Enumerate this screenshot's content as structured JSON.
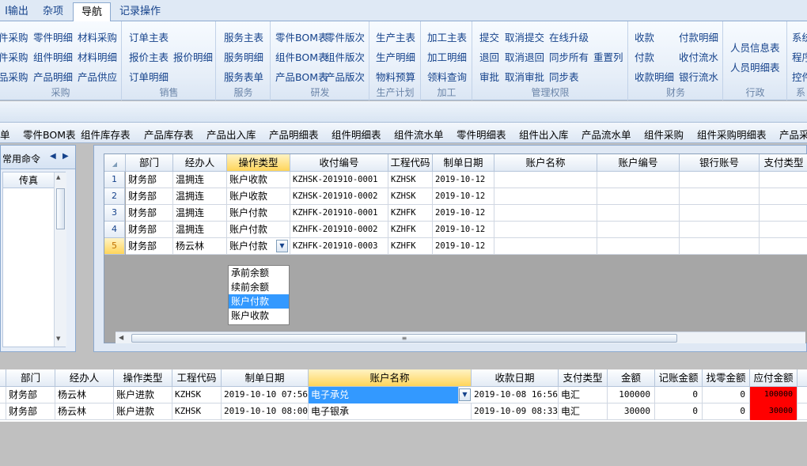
{
  "ribbon_tabs": [
    {
      "label": "I输出",
      "active": false
    },
    {
      "label": "杂项",
      "active": false
    },
    {
      "label": "导航",
      "active": true
    },
    {
      "label": "记录操作",
      "active": false
    }
  ],
  "ribbon_groups": {
    "caigou": {
      "label": "采购",
      "items": [
        "件采购",
        "零件明细",
        "材料采购",
        "件采购",
        "组件明细",
        "材料明细",
        "品采购",
        "产品明细",
        "产品供应"
      ]
    },
    "xiaoshou": {
      "label": "销售",
      "items": [
        "订单主表",
        "报价主表",
        "报价明细",
        "订单明细"
      ]
    },
    "fuwu": {
      "label": "服务",
      "items": [
        "服务主表",
        "服务明细",
        "服务表单"
      ]
    },
    "yanfa": {
      "label": "研发",
      "items": [
        "零件BOM表",
        "零件版次",
        "组件BOM表",
        "组件版次",
        "产品BOM表",
        "产品版次"
      ]
    },
    "shengchan": {
      "label": "生产计划",
      "items": [
        "生产主表",
        "生产明细",
        "物料预算"
      ]
    },
    "jiagong": {
      "label": "加工",
      "items": [
        "加工主表",
        "加工明细",
        "领料查询"
      ]
    },
    "guanli": {
      "label": "管理权限",
      "items": [
        "提交",
        "取消提交",
        "在线升级",
        "退回",
        "取消退回",
        "同步所有",
        "重置列",
        "审批",
        "取消审批",
        "同步表"
      ]
    },
    "caiwu": {
      "label": "财务",
      "items": [
        "收款",
        "付款明细",
        "付款",
        "收付流水",
        "收款明细",
        "银行流水"
      ]
    },
    "xingzheng": {
      "label": "行政",
      "items": [
        "人员信息表",
        "人员明细表"
      ]
    },
    "xitong": {
      "label": "系",
      "items": [
        "系统",
        "程序",
        "控件"
      ]
    }
  },
  "nav_items": [
    "单",
    "零件BOM表",
    "组件库存表",
    "产品库存表",
    "产品出入库",
    "产品明细表",
    "组件明细表",
    "组件流水单",
    "零件明细表",
    "组件出入库",
    "产品流水单",
    "组件采购",
    "组件采购明细表",
    "产品采"
  ],
  "left_panel": {
    "title": "常用命令",
    "column": "传真"
  },
  "main_grid": {
    "columns": [
      "部门",
      "经办人",
      "操作类型",
      "收付编号",
      "工程代码",
      "制单日期",
      "账户名称",
      "账户编号",
      "银行账号",
      "支付类型"
    ],
    "rows": [
      {
        "num": "1",
        "cells": [
          "财务部",
          "温拥连",
          "账户收款",
          "KZHSK-201910-0001",
          "KZHSK",
          "2019-10-12",
          "",
          "",
          "",
          ""
        ]
      },
      {
        "num": "2",
        "cells": [
          "财务部",
          "温拥连",
          "账户收款",
          "KZHSK-201910-0002",
          "KZHSK",
          "2019-10-12",
          "",
          "",
          "",
          ""
        ]
      },
      {
        "num": "3",
        "cells": [
          "财务部",
          "温拥连",
          "账户付款",
          "KZHFK-201910-0001",
          "KZHFK",
          "2019-10-12",
          "",
          "",
          "",
          ""
        ]
      },
      {
        "num": "4",
        "cells": [
          "财务部",
          "温拥连",
          "账户付款",
          "KZHFK-201910-0002",
          "KZHFK",
          "2019-10-12",
          "",
          "",
          "",
          ""
        ]
      },
      {
        "num": "5",
        "cells": [
          "财务部",
          "杨云林",
          "账户付款",
          "KZHFK-201910-0003",
          "KZHFK",
          "2019-10-12",
          "",
          "",
          "",
          ""
        ]
      }
    ],
    "dropdown_options": [
      "承前余额",
      "续前余额",
      "账户付款",
      "账户收款"
    ],
    "dropdown_selected": "账户付款"
  },
  "bottom_grid": {
    "columns": [
      "部门",
      "经办人",
      "操作类型",
      "工程代码",
      "制单日期",
      "账户名称",
      "收款日期",
      "支付类型",
      "金额",
      "记账金额",
      "找零金额",
      "应付金额"
    ],
    "rows": [
      {
        "cells": [
          "财务部",
          "杨云林",
          "账户进款",
          "KZHSK",
          "2019-10-10 07:56",
          "电子承兑",
          "2019-10-08 16:56",
          "电汇",
          "100000",
          "0",
          "0",
          "100000"
        ]
      },
      {
        "cells": [
          "财务部",
          "杨云林",
          "账户进款",
          "KZHSK",
          "2019-10-10 08:00",
          "电子银承",
          "2019-10-09 08:33",
          "电汇",
          "30000",
          "0",
          "0",
          "30000"
        ]
      }
    ]
  },
  "colors": {
    "highlight": "#3399ff",
    "selected_header": "#ffd55a",
    "alert": "#ff0000",
    "ribbon_text": "#15428b"
  }
}
